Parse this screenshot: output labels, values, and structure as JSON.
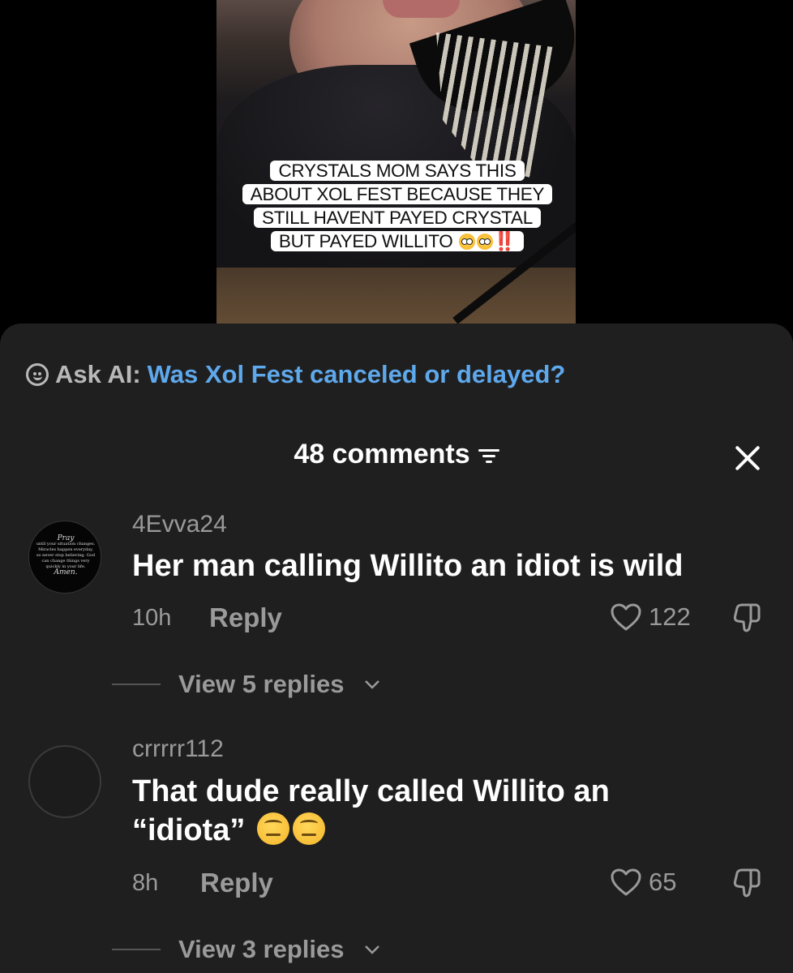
{
  "video": {
    "caption_lines": [
      "CRYSTALS MOM SAYS THIS",
      "ABOUT XOL FEST BECAUSE THEY",
      "STILL HAVENT PAYED CRYSTAL",
      "BUT PAYED WILLITO"
    ],
    "caption_suffix": "‼️"
  },
  "ask_ai": {
    "label": "Ask AI:",
    "question": "Was Xol Fest canceled or delayed?"
  },
  "comments_header": {
    "title": "48 comments"
  },
  "comments": [
    {
      "username": "4Evva24",
      "text": "Her man calling Willito an idiot is wild",
      "time": "10h",
      "reply_label": "Reply",
      "likes": "122",
      "view_replies": "View 5 replies",
      "avatar_text": {
        "script": "Pray",
        "body": "until your situation changes. Miracles happen everyday, so never stop believing. God can change things very quickly in your life.",
        "sign": "Amen."
      }
    },
    {
      "username": "crrrrr112",
      "text_line1": "That dude really called Willito an",
      "text_line2": "“idiota”",
      "time": "8h",
      "reply_label": "Reply",
      "likes": "65",
      "view_replies": "View 3 replies"
    }
  ],
  "colors": {
    "sheet_bg": "#1f1f1f",
    "accent_blue": "#5ea8ec",
    "muted_text": "#9a9a9a"
  }
}
